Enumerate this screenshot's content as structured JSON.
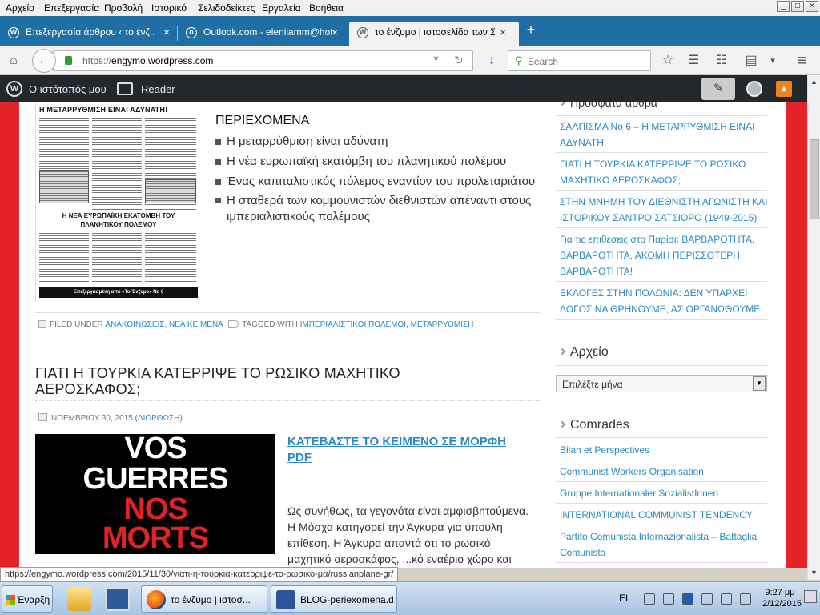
{
  "menubar": {
    "items": [
      "Αρχείο",
      "Επεξεργασία",
      "Προβολή",
      "Ιστορικό",
      "Σελιδοδείκτες",
      "Εργαλεία",
      "Βοήθεια"
    ],
    "min": "_",
    "max": "□",
    "close": "×"
  },
  "tabs": [
    {
      "label": "Επεξεργασία άρθρου ‹ το ένζ...",
      "icon": "W",
      "close": "×"
    },
    {
      "label": "Outlook.com - eleniiamm@hot...",
      "icon": "o",
      "close": "×"
    },
    {
      "label": "το ένζυμο | ιστοσελίδα των Σ...",
      "icon": "W",
      "close": "×"
    }
  ],
  "newtab": "+",
  "nav": {
    "url_prefix": "https://",
    "url_domain": "engymo.wordpress.com",
    "search_placeholder": "Search",
    "home": "⌂",
    "back": "←",
    "reload": "↻",
    "dropdown": "▼",
    "download": "↓",
    "star": "☆",
    "bookmarks": "☰",
    "extra1": "☷",
    "extra2": "▤",
    "menu": "≡",
    "more": "▾"
  },
  "wpbar": {
    "my_site": "Ο ιστότοπός μου",
    "reader": "Reader",
    "write": "✎",
    "notif": "▲"
  },
  "article1": {
    "paper_headline": "Η ΜΕΤΑΡΡΥΘΜΙΣΗ ΕΙΝΑΙ ΑΔΥΝΑΤΗ!",
    "paper_sub": "Η ΝΕΑ ΕΥΡΩΠΑΪΚΗ ΕΚΑΤΟΜΒΗ ΤΟΥ ΠΛΑΝΗΤΙΚΟΥ ΠΟΛΕΜΟΥ",
    "paper_footer": "Επεξεργασμένη από «Το Ένζυμο» Νο 6",
    "toc_heading": "ΠΕΡΙΕΧΟΜΕΝΑ",
    "toc": [
      "Η μεταρρύθμιση είναι αδύνατη",
      "Η νέα ευρωπαϊκή εκατόμβη του πλανητικού πολέμου",
      "Ένας καπιταλιστικός πόλεμος εναντίον του προλεταριάτου",
      "Η σταθερά των κομμουνιστών διεθνιστών απέναντι στους ιμπεριαλιστικούς πολέμους"
    ],
    "filed_under": "FILED UNDER",
    "cat1": "ΑΝΑΚΟΙΝΩΣΕΙΣ",
    "cat2": "ΝΕΑ ΚΕΙΜΕΝΑ",
    "tagged_with": "TAGGED WITH",
    "tag1": "ΙΜΠΕΡΙΑΛΙΣΤΙΚΟΙ ΠΟΛΕΜΟΙ",
    "tag2": "ΜΕΤΑΡΡΥΘΜΙΣΗ",
    "sep": ","
  },
  "article2": {
    "title": "ΓΙΑΤΙ Η ΤΟΥΡΚΙΑ ΚΑΤΕΡΡΙΨΕ ΤΟ ΡΩΣΙΚΟ ΜΑΧΗΤΙΚΟ ΑΕΡΟΣΚΑΦΟΣ;",
    "date": "ΝΟΕΜΒΡΙΟΥ 30, 2015",
    "edit": "(ΔΙΟΡΘΩΣΗ)",
    "poster_l1": "VOS",
    "poster_l2": "GUERRES",
    "poster_l3": "NOS",
    "poster_l4": "MORTS",
    "download_link": "ΚΑΤΕΒΑΣΤΕ ΤΟ ΚΕΙΜΕΝΟ ΣΕ ΜΟΡΦΗ PDF",
    "body": "Ως συνήθως, τα γεγονότα είναι αμφισβητούμενα. Η Μόσχα κατηγορεί την Άγκυρα για ύπουλη επίθεση. Η Άγκυρα απαντά ότι το ρωσικό μαχητικό αεροσκάφος, ...κό εναέριο χώρο και"
  },
  "sidebar": {
    "recent_partial": "Πρόσφατα άρθρα",
    "recent": [
      "ΣΑΛΠΙΣΜΑ Νο 6 – Η ΜΕΤΑΡΡΥΘΜΙΣΗ ΕΙΝΑΙ ΑΔΥΝΑΤΗ!",
      "ΓΙΑΤΙ Η ΤΟΥΡΚΙΑ ΚΑΤΕΡΡΙΨΕ ΤΟ ΡΩΣΙΚΟ ΜΑΧΗΤΙΚΟ ΑΕΡΟΣΚΑΦΟΣ;",
      "ΣΤΗΝ ΜΝΗΜΗ ΤΟΥ ΔΙΕΘΝΙΣΤΗ ΑΓΩΝΙΣΤΗ ΚΑΙ ΙΣΤΟΡΙΚΟΥ ΣΑΝΤΡΟ ΣΑΤΣΙΟΡΟ (1949-2015)",
      "Για τις επιθέσεις στο Παρίσι: ΒΑΡΒΑΡΟΤΗΤΑ, ΒΑΡΒΑΡΟΤΗΤΑ, ΑΚΟΜΗ ΠΕΡΙΣΣΟΤΕΡΗ ΒΑΡΒΑΡΟΤΗΤΑ!",
      "ΕΚΛΟΓΕΣ ΣΤΗΝ ΠΟΛΩΝΙΑ: ΔΕΝ ΥΠΑΡΧΕΙ ΛΟΓΟΣ ΝΑ ΘΡΗΝΟΥΜΕ, ΑΣ ΟΡΓΑΝΩΘΟΥΜΕ"
    ],
    "archive_title": "Αρχείο",
    "archive_select": "Επιλέξτε μήνα",
    "comrades_title": "Comrades",
    "comrades": [
      "Bilan et Perspectives",
      "Communist Workers Organisation",
      "Gruppe Internationaler SozialistInnen",
      "INTERNATIONAL COMMUNIST TENDENCY",
      "Partito Comunista Internazionalista – Battaglia Comunista"
    ]
  },
  "status_url": "https://engymo.wordpress.com/2015/11/30/γιατι-η-τουρκια-κατερριψε-το-ρωσικο-μα/russianplane-gr/",
  "taskbar": {
    "start": "Έναρξη",
    "task1": "το ένζυμο | ιστοσ...",
    "task2": "BLOG-periexomena.d...",
    "lang": "EL",
    "time": "9:27 μμ",
    "date": "2/12/2015"
  },
  "colors": {
    "tab_blue": "#1f6fa4",
    "link_blue": "#2a8ac4",
    "page_red": "#e4242a",
    "poster_red": "#e12323",
    "wp_bar": "#23282d",
    "notif_orange": "#f0821e"
  }
}
